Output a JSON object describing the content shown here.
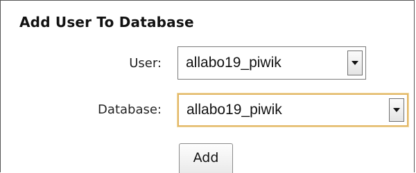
{
  "form": {
    "title": "Add User To Database",
    "user_label": "User:",
    "user_value": "allabo19_piwik",
    "database_label": "Database:",
    "database_value": "allabo19_piwik",
    "add_button_label": "Add"
  },
  "colors": {
    "focus_border": "#e2b766",
    "panel_border": "#555555"
  },
  "icons": {
    "dropdown": "chevron-down-icon"
  }
}
